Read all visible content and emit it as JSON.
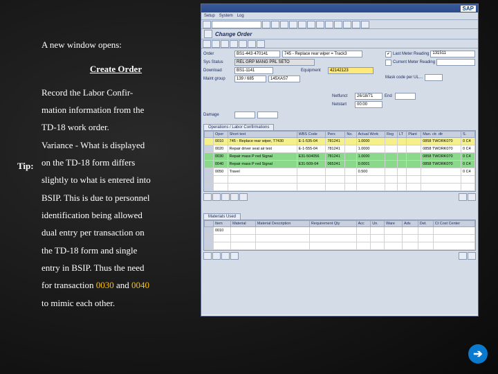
{
  "instruction": {
    "intro": "A new window opens:",
    "title": "Create Order",
    "para1a": "Record the Labor Confir-",
    "para1b": "mation information from the",
    "para1c": "TD-18 work order.",
    "tip_label": "Tip:",
    "tip_a": "Variance - What is displayed",
    "tip_b": "on the TD-18 form differs",
    "tip_c": "slightly to what is entered into",
    "tip_d": "BSIP. This is due to personnel",
    "tip_e": "identification being allowed",
    "tip_f": "dual entry per transaction on",
    "tip_g": "the TD-18 form and single",
    "tip_h": "entry in BSIP. Thus the need",
    "tip_i_pre": "for transaction ",
    "tip_i_n1": "0030",
    "tip_i_mid": " and ",
    "tip_i_n2": "0040",
    "tip_j": "to mimic each other."
  },
  "sap": {
    "title_left": " ",
    "title_right": "SAP",
    "menu": {
      "m1": "Setup",
      "m2": "System",
      "m3": "Log"
    },
    "screen_title": "Change Order",
    "header": {
      "order_label": "Order",
      "order_val": "BS1-443·470141",
      "order_desc": "745 - Replace rear wiper = Track3",
      "sys_status_label": "Sys Status",
      "sys_status": "REL GRP MANG PRL SETO",
      "download_label": "Download",
      "download_val": "BS1-1141",
      "equip_label": "Equipment",
      "equip_val": "42142123",
      "maint_group_label": "Maint group",
      "maint_group": "139 / 685",
      "maint_group2": "145XAS7"
    },
    "right": {
      "chk1_label": "Last Meter Reading",
      "chk1_val": "131511",
      "chk2_label": "Current Meter Reading",
      "chk2_val": "",
      "mask_label": "Mask code per UL…",
      "mask_val": ""
    },
    "mid": {
      "damage_label": "Damage",
      "netfunct_label": "Netfunct",
      "netfunct_val": "26/18/71",
      "netfunct_end_label": "End",
      "netstart_label": "Netstart",
      "netstart_val": "00:00"
    },
    "ops_tab": "Operations / Labor Confirmations",
    "ops_cols": {
      "c1": "Oper",
      "c2": "Short text",
      "c3": "WBS Code",
      "c4": "Pers",
      "c5": "No.",
      "c6": "Actual Work",
      "c7": "Reg",
      "c8": "LT",
      "c9": "Plant",
      "c10": "Man. ctr. dtr",
      "c11": "S."
    },
    "ops_rows": [
      {
        "op": "0010",
        "txt": "745 - Replace rear wiper, T7430",
        "wbs": "E-1-535-04",
        "pers": "781241",
        "no": "",
        "work": "1.0000",
        "reg": "",
        "lt": "",
        "plant": "",
        "man": "0858 TWORK070",
        "s": "0 C4"
      },
      {
        "op": "0020",
        "txt": "Repair driver seat air test",
        "wbs": "E-1-555-04",
        "pers": "781241",
        "no": "",
        "work": "1.0000",
        "reg": "",
        "lt": "",
        "plant": "",
        "man": "0858 TWORK070",
        "s": "0 C4"
      },
      {
        "op": "0030",
        "txt": "Repair mass P red Signal",
        "wbs": "E31-504056",
        "pers": "781241",
        "no": "",
        "work": "1.0000",
        "reg": "",
        "lt": "",
        "plant": "",
        "man": "0858 TWORK070",
        "s": "0 C4"
      },
      {
        "op": "0040",
        "txt": "Repair mass P red Signal",
        "wbs": "E31-509-04",
        "pers": "065241",
        "no": "",
        "work": "0.0001",
        "reg": "",
        "lt": "",
        "plant": "",
        "man": "0858 TWORK070",
        "s": "0 C4"
      },
      {
        "op": "0050",
        "txt": "Travel",
        "wbs": "",
        "pers": "",
        "no": "",
        "work": "0.500",
        "reg": "",
        "lt": "",
        "plant": "",
        "man": "",
        "s": "0 C4"
      }
    ],
    "mat_tab": "Materials Used",
    "mat_cols": {
      "c1": "Item",
      "c2": "Material",
      "c3": "Material Description",
      "c4": "Requirement Qty",
      "c5": "Acc",
      "c6": "Un.",
      "c7": "Ware",
      "c8": "Adv.",
      "c9": "Det.",
      "c10": "Ct Cost Center"
    },
    "mat_rows": [
      {
        "item": "0010",
        "mat": "",
        "desc": "",
        "qty": "",
        "acc": "",
        "un": "",
        "ware": "",
        "adv": "",
        "det": "",
        "cc": ""
      }
    ]
  },
  "next_arrow": "➔"
}
